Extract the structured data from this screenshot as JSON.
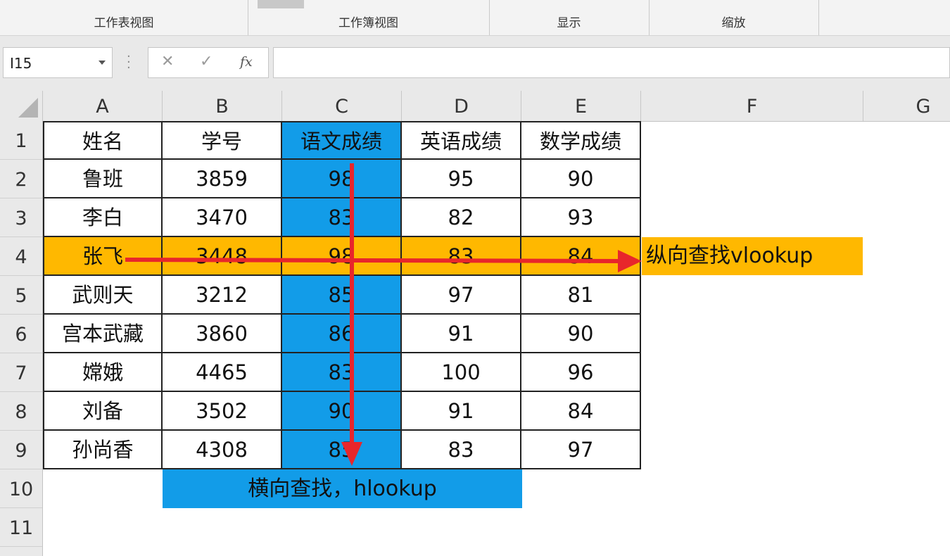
{
  "ribbon": {
    "groups": [
      {
        "label": "工作表视图"
      },
      {
        "label": "工作簿视图"
      },
      {
        "label": "显示"
      },
      {
        "label": "缩放"
      }
    ]
  },
  "formula_bar": {
    "name_box": "I15",
    "cancel_symbol": "✕",
    "enter_symbol": "✓",
    "fx_symbol": "fx",
    "formula": ""
  },
  "columns": [
    "A",
    "B",
    "C",
    "D",
    "E",
    "F",
    "G"
  ],
  "rows": [
    "1",
    "2",
    "3",
    "4",
    "5",
    "6",
    "7",
    "8",
    "9",
    "10",
    "11"
  ],
  "table": {
    "headers": [
      "姓名",
      "学号",
      "语文成绩",
      "英语成绩",
      "数学成绩"
    ],
    "data": [
      [
        "鲁班",
        "3859",
        "98",
        "95",
        "90"
      ],
      [
        "李白",
        "3470",
        "83",
        "82",
        "93"
      ],
      [
        "张飞",
        "3448",
        "98",
        "83",
        "84"
      ],
      [
        "武则天",
        "3212",
        "85",
        "97",
        "81"
      ],
      [
        "宫本武藏",
        "3860",
        "86",
        "91",
        "90"
      ],
      [
        "嫦娥",
        "4465",
        "83",
        "100",
        "96"
      ],
      [
        "刘备",
        "3502",
        "90",
        "91",
        "84"
      ],
      [
        "孙尚香",
        "4308",
        "85",
        "83",
        "97"
      ]
    ]
  },
  "annotations": {
    "vertical_lookup": "纵向查找vlookup",
    "horizontal_lookup": "横向查找，hlookup"
  },
  "colors": {
    "row_highlight": "#FFB800",
    "column_highlight": "#129CE8",
    "arrow": "#E8262B"
  }
}
